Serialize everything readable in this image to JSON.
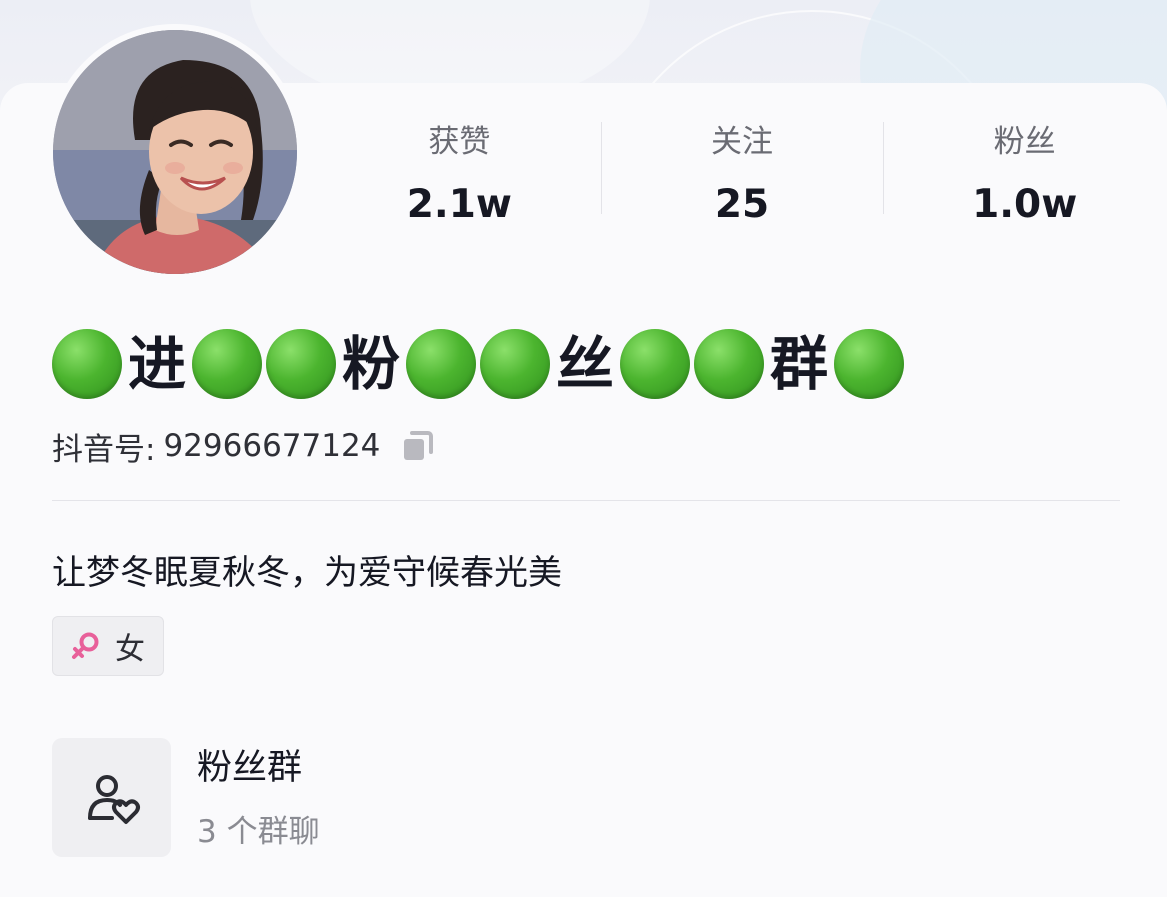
{
  "profile": {
    "avatar_description": "avatar",
    "nickname": {
      "segments": [
        "",
        "进",
        "",
        "",
        "粉",
        "",
        "",
        "丝",
        "",
        "",
        "群",
        ""
      ],
      "chars": [
        "进",
        "粉",
        "丝",
        "群"
      ]
    },
    "douyin_id_label": "抖音号:",
    "douyin_id_value": "92966677124",
    "bio": "让梦冬眠夏秋冬，为爱守候春光美",
    "gender_label": "女"
  },
  "stats": [
    {
      "label": "获赞",
      "value": "2.1w"
    },
    {
      "label": "关注",
      "value": "25"
    },
    {
      "label": "粉丝",
      "value": "1.0w"
    }
  ],
  "fan_group": {
    "title": "粉丝群",
    "subtitle": "3 个群聊"
  },
  "colors": {
    "dot_green": "#4cb52f",
    "female_pink": "#e8609a",
    "text_primary": "#161823",
    "text_secondary": "#8a8b92"
  },
  "icons": {
    "copy": "copy-icon",
    "gender": "female-icon",
    "fan_group": "user-heart-icon",
    "dot": "green-circle-emoji"
  }
}
